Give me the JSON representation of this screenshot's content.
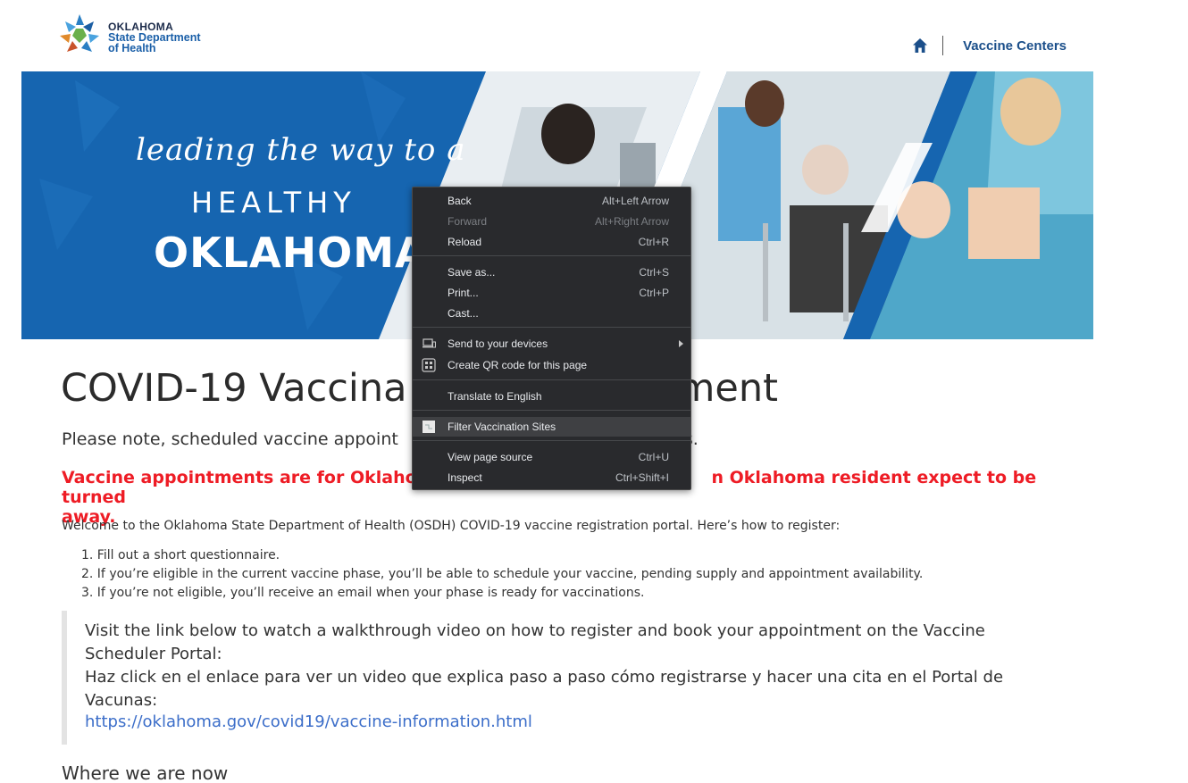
{
  "header": {
    "logo": {
      "line1": "OKLAHOMA",
      "line2": "State Department",
      "line3": "of Health"
    },
    "nav": {
      "home_icon": "home-icon",
      "vaccine_centers": "Vaccine Centers"
    }
  },
  "banner": {
    "tagline": "leading the way to a",
    "healthy": "HEALTHY",
    "oklahoma": "OKLAHOMA"
  },
  "main": {
    "title": "COVID-19 Vaccina",
    "title_tail": "ment",
    "note_start": "Please note, scheduled vaccine appoint",
    "note_end": "s.",
    "warning_start": "Vaccine appointments are for Oklahom",
    "warning_end": "n Oklahoma resident expect to be turned",
    "warning_line2": "away.",
    "welcome": "Welcome to the Oklahoma State Department of Health (OSDH) COVID-19 vaccine registration portal. Here’s how to register:",
    "steps": [
      "1. Fill out a short questionnaire.",
      "2. If you’re eligible in the current vaccine phase, you’ll be able to schedule your vaccine, pending supply and appointment availability.",
      "3. If you’re not eligible, you’ll receive an email when your phase is ready for vaccinations."
    ],
    "callout": {
      "en": "Visit the link below to watch a walkthrough video on how to register and book your appointment on the Vaccine Scheduler Portal:",
      "es": "Haz click en el enlace para ver un video que explica paso a paso cómo registrarse y hacer una cita en el Portal de Vacunas:",
      "link": "https://oklahoma.gov/covid19/vaccine-information.html"
    },
    "where": "Where we are now"
  },
  "context_menu": {
    "items": [
      {
        "label": "Back",
        "shortcut": "Alt+Left Arrow"
      },
      {
        "label": "Forward",
        "shortcut": "Alt+Right Arrow"
      },
      {
        "label": "Reload",
        "shortcut": "Ctrl+R"
      },
      {
        "label": "Save as...",
        "shortcut": "Ctrl+S"
      },
      {
        "label": "Print...",
        "shortcut": "Ctrl+P"
      },
      {
        "label": "Cast...",
        "shortcut": ""
      },
      {
        "label": "Send to your devices",
        "shortcut": ""
      },
      {
        "label": "Create QR code for this page",
        "shortcut": ""
      },
      {
        "label": "Translate to English",
        "shortcut": ""
      },
      {
        "label": "Filter Vaccination Sites",
        "shortcut": ""
      },
      {
        "label": "View page source",
        "shortcut": "Ctrl+U"
      },
      {
        "label": "Inspect",
        "shortcut": "Ctrl+Shift+I"
      }
    ]
  },
  "colors": {
    "banner_blue": "#1665b0",
    "warning_red": "#ee1c25",
    "link_blue": "#3c6ec9",
    "nav_blue": "#1b4f8a",
    "menu_bg": "#292a2d"
  }
}
